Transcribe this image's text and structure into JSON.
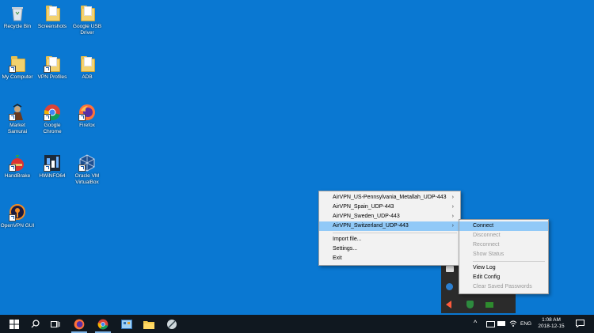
{
  "desktop": {
    "icons": [
      {
        "label": "Recycle Bin",
        "icon": "recycle-bin-icon"
      },
      {
        "label": "Screenshots",
        "icon": "folder-icon"
      },
      {
        "label": "Google USB Driver",
        "icon": "folder-icon"
      },
      {
        "label": "My Computer",
        "icon": "folder-icon"
      },
      {
        "label": "VPN Profiles",
        "icon": "folder-icon"
      },
      {
        "label": "ADB",
        "icon": "folder-icon"
      },
      {
        "label": "Market Samurai",
        "icon": "samurai-icon"
      },
      {
        "label": "Google Chrome",
        "icon": "chrome-icon"
      },
      {
        "label": "Firefox",
        "icon": "firefox-icon"
      },
      {
        "label": "HandBrake",
        "icon": "handbrake-icon"
      },
      {
        "label": "HWiNFO64",
        "icon": "hwinfo-icon"
      },
      {
        "label": "Oracle VM VirtualBox",
        "icon": "virtualbox-icon"
      },
      {
        "label": "OpenVPN GUI",
        "icon": "openvpn-icon"
      }
    ]
  },
  "context_menu": {
    "items": [
      {
        "label": "AirVPN_US-Pennsylvania_Metallah_UDP-443",
        "has_submenu": true
      },
      {
        "label": "AirVPN_Spain_UDP-443",
        "has_submenu": true
      },
      {
        "label": "AirVPN_Sweden_UDP-443",
        "has_submenu": true
      },
      {
        "label": "AirVPN_Switzerland_UDP-443",
        "has_submenu": true,
        "highlighted": true
      },
      {
        "label": "Import file..."
      },
      {
        "label": "Settings..."
      },
      {
        "label": "Exit"
      }
    ],
    "arrow": "›"
  },
  "submenu": {
    "items": [
      {
        "label": "Connect",
        "enabled": true,
        "highlighted": true
      },
      {
        "label": "Disconnect",
        "enabled": false
      },
      {
        "label": "Reconnect",
        "enabled": false
      },
      {
        "label": "Show Status",
        "enabled": false
      },
      {
        "label": "View Log",
        "enabled": true
      },
      {
        "label": "Edit Config",
        "enabled": true
      },
      {
        "label": "Clear Saved Passwords",
        "enabled": false
      }
    ]
  },
  "taskbar": {
    "apps": [
      "firefox-icon",
      "chrome-icon",
      "control-panel-icon",
      "file-explorer-icon",
      "snipping-tool-icon"
    ],
    "tray": {
      "chevron": "^",
      "language": "ENG",
      "time": "1:08 AM",
      "date": "2018-12-15"
    }
  },
  "colors": {
    "desktop": "#0a78d2",
    "taskbar": "#101820",
    "menu_highlight": "#91c9f7"
  }
}
